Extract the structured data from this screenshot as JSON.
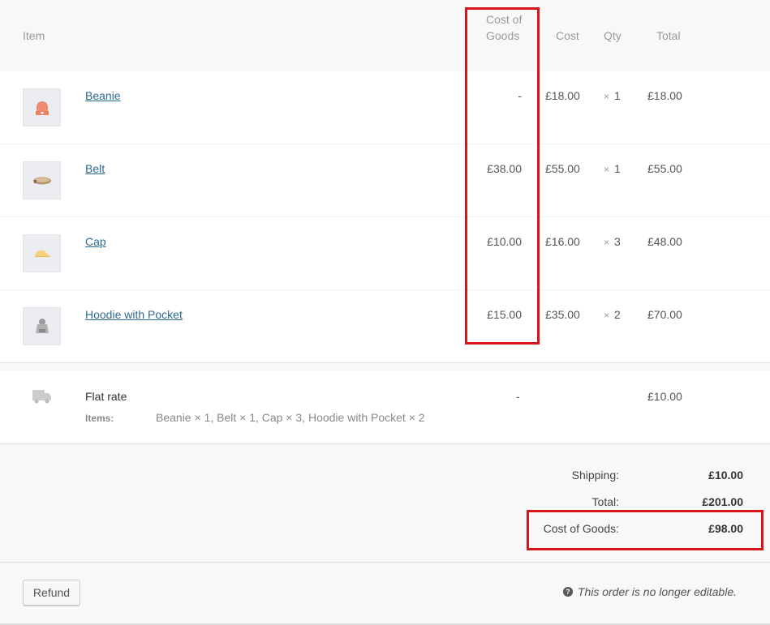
{
  "headers": {
    "item": "Item",
    "cost_of_goods": "Cost of Goods",
    "cost": "Cost",
    "qty": "Qty",
    "total": "Total"
  },
  "items": [
    {
      "name": "Beanie",
      "icon": "beanie-icon",
      "cost_of_goods": "-",
      "cost": "£18.00",
      "qty_symbol": "×",
      "qty": "1",
      "total": "£18.00"
    },
    {
      "name": "Belt",
      "icon": "belt-icon",
      "cost_of_goods": "£38.00",
      "cost": "£55.00",
      "qty_symbol": "×",
      "qty": "1",
      "total": "£55.00"
    },
    {
      "name": "Cap",
      "icon": "cap-icon",
      "cost_of_goods": "£10.00",
      "cost": "£16.00",
      "qty_symbol": "×",
      "qty": "3",
      "total": "£48.00"
    },
    {
      "name": "Hoodie with Pocket",
      "icon": "hoodie-icon",
      "cost_of_goods": "£15.00",
      "cost": "£35.00",
      "qty_symbol": "×",
      "qty": "2",
      "total": "£70.00"
    }
  ],
  "shipping": {
    "icon": "truck-icon",
    "name": "Flat rate",
    "items_label": "Items:",
    "items_value": "Beanie × 1, Belt × 1, Cap × 3, Hoodie with Pocket × 2",
    "cost_of_goods": "-",
    "total": "£10.00"
  },
  "totals": [
    {
      "label": "Shipping:",
      "value": "£10.00"
    },
    {
      "label": "Total:",
      "value": "£201.00"
    },
    {
      "label": "Cost of Goods:",
      "value": "£98.00"
    }
  ],
  "footer": {
    "refund_label": "Refund",
    "help_icon": "?",
    "note": "This order is no longer editable."
  },
  "colors": {
    "highlight": "#d7141a",
    "link": "#2b6a91"
  }
}
